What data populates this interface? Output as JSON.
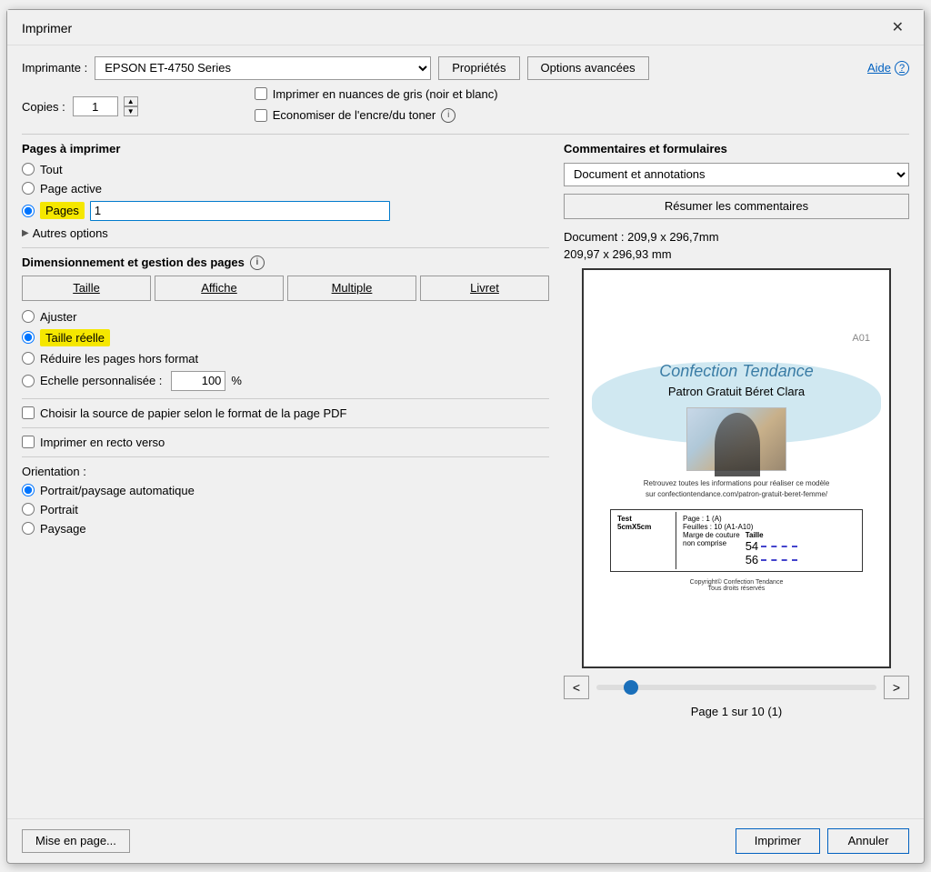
{
  "dialog": {
    "title": "Imprimer",
    "close_label": "✕"
  },
  "header": {
    "printer_label": "Imprimante :",
    "printer_value": "EPSON ET-4750 Series",
    "properties_btn": "Propriétés",
    "advanced_btn": "Options avancées",
    "aide_label": "Aide",
    "copies_label": "Copies :",
    "copies_value": "1",
    "grayscale_label": "Imprimer en nuances de gris (noir et blanc)",
    "save_ink_label": "Economiser de l'encre/du toner"
  },
  "pages_section": {
    "title": "Pages à imprimer",
    "tout_label": "Tout",
    "page_active_label": "Page active",
    "pages_label": "Pages",
    "pages_value": "1",
    "autres_label": "Autres options"
  },
  "dim_section": {
    "title": "Dimensionnement et gestion des pages",
    "taille_btn": "Taille",
    "affiche_btn": "Affiche",
    "multiple_btn": "Multiple",
    "livret_btn": "Livret",
    "ajuster_label": "Ajuster",
    "taille_reelle_label": "Taille réelle",
    "reduire_label": "Réduire les pages hors format",
    "echelle_label": "Echelle personnalisée :",
    "echelle_value": "100",
    "echelle_unit": "%",
    "source_label": "Choisir la source de papier selon le format de la page PDF",
    "recto_verso_label": "Imprimer en recto verso"
  },
  "orientation_section": {
    "title": "Orientation :",
    "portrait_paysage_label": "Portrait/paysage automatique",
    "portrait_label": "Portrait",
    "paysage_label": "Paysage"
  },
  "comments_section": {
    "title": "Commentaires et formulaires",
    "select_value": "Document et annotations",
    "resume_btn": "Résumer les commentaires",
    "doc_info": "Document : 209,9 x 296,7mm",
    "page_size": "209,97 x 296,93 mm"
  },
  "preview": {
    "tag": "A01",
    "title_script": "Confection Tendance",
    "subtitle": "Patron Gratuit Béret Clara",
    "body_text": "Retrouvez toutes les informations pour réaliser ce modèle\nsur confectiontendance.com/patron-gratuit-beret-femme/",
    "page_info_inner": "Page : 1 (A)\nFeuilles : 10 (A1-A10)",
    "test_label": "Test\n5cmX5cm",
    "marge_label": "Marge de couture\nnon comprise",
    "taille_label": "Taille",
    "size_54": "54",
    "size_56": "56",
    "copyright": "Copyright© Confection Tendance\nTous droits réservés"
  },
  "nav": {
    "prev_btn": "<",
    "next_btn": ">",
    "page_info": "Page 1 sur 10 (1)"
  },
  "footer": {
    "mise_en_page_btn": "Mise en page...",
    "imprimer_btn": "Imprimer",
    "annuler_btn": "Annuler"
  }
}
